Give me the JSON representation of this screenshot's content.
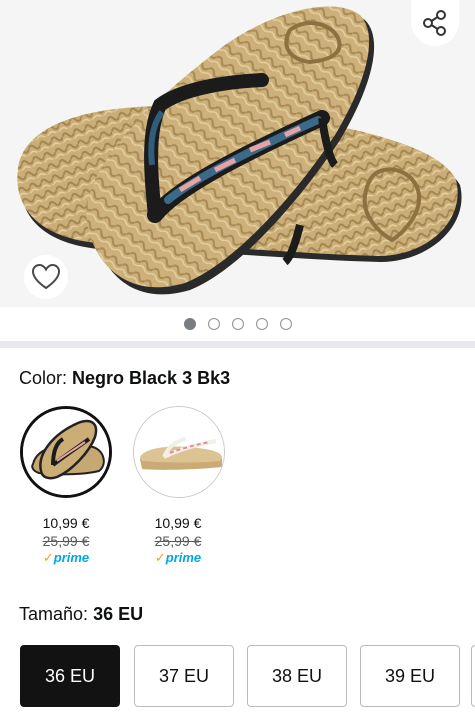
{
  "product": {
    "image_alt": "Flip flop sandals with rope-textured sole",
    "carousel": {
      "total": 5,
      "active_index": 0
    }
  },
  "icons": {
    "share": "share-icon",
    "favorite": "heart-icon"
  },
  "color": {
    "label": "Color:",
    "selected_value": "Negro Black 3 Bk3",
    "options": [
      {
        "name": "Negro Black 3 Bk3",
        "price": "10,99 €",
        "old_price": "25,99 €",
        "prime_check": "✓",
        "prime_label": "prime",
        "selected": true
      },
      {
        "name": "Beige",
        "price": "10,99 €",
        "old_price": "25,99 €",
        "prime_check": "✓",
        "prime_label": "prime",
        "selected": false
      }
    ]
  },
  "size": {
    "label": "Tamaño:",
    "selected_value": "36 EU",
    "options": [
      "36 EU",
      "37 EU",
      "38 EU",
      "39 EU"
    ]
  },
  "colors": {
    "accent_prime": "#00a8e1",
    "prime_check": "#f7a21b",
    "selected_size_bg": "#121212",
    "rope": "#c8a872"
  }
}
